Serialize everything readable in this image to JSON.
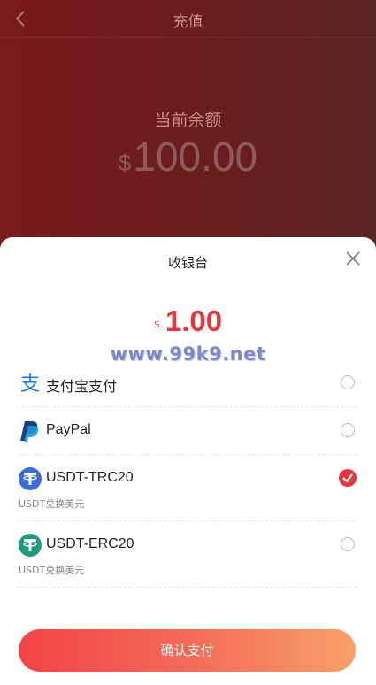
{
  "header": {
    "title": "充值",
    "back_icon": "chevron-left-icon"
  },
  "balance": {
    "label": "当前余额",
    "currency": "$",
    "value": "100.00"
  },
  "cashier": {
    "title": "收银台",
    "amount_currency": "$",
    "amount": "1.00",
    "watermark": "www.99k9.net"
  },
  "methods": [
    {
      "label": "支付宝支付",
      "icon": "alipay-icon",
      "selected": false
    },
    {
      "label": "PayPal",
      "icon": "paypal-icon",
      "selected": false
    },
    {
      "label": "USDT-TRC20",
      "sub": "USDT兑换美元",
      "icon": "tether-icon",
      "selected": true
    },
    {
      "label": "USDT-ERC20",
      "sub": "USDT兑换美元",
      "icon": "tether-icon",
      "selected": false
    }
  ],
  "confirm_label": "确认支付",
  "colors": {
    "accent": "#e8343e",
    "alipay": "#1677ff",
    "paypal_dark": "#253b80",
    "paypal_light": "#179bd7",
    "trc20": "#3b6fd8",
    "erc20": "#1f9b7b",
    "header_bg": "#6e1c1e"
  }
}
